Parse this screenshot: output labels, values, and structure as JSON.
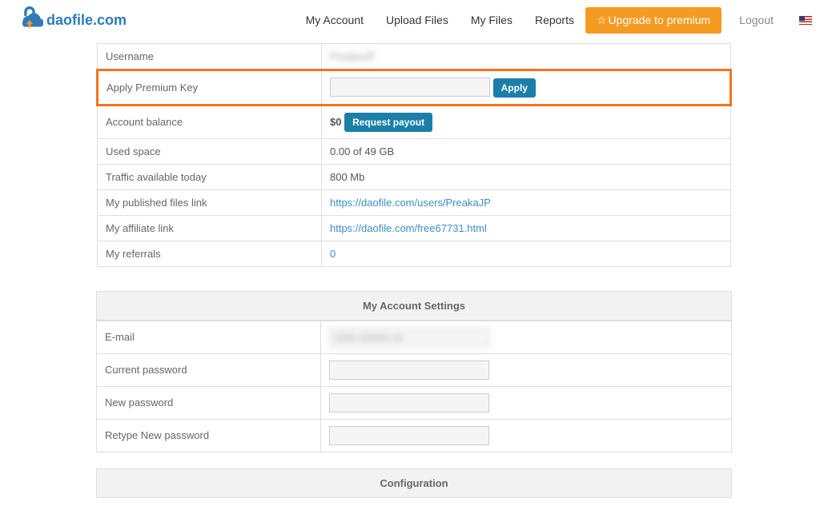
{
  "header": {
    "site_name": "daofile.com",
    "nav": {
      "my_account": "My Account",
      "upload_files": "Upload Files",
      "my_files": "My Files",
      "reports": "Reports",
      "upgrade": "Upgrade to premium",
      "logout": "Logout"
    }
  },
  "account": {
    "username_label": "Username",
    "username_value": "PreakaJP",
    "apply_premium_label": "Apply Premium Key",
    "apply_btn": "Apply",
    "balance_label": "Account balance",
    "balance_value": "$0",
    "request_payout_btn": "Request payout",
    "used_space_label": "Used space",
    "used_space_value": "0.00 of 49 GB",
    "traffic_label": "Traffic available today",
    "traffic_value": "800 Mb",
    "published_label": "My published files link",
    "published_link": "https://daofile.com/users/PreakaJP",
    "affiliate_label": "My affiliate link",
    "affiliate_link": "https://daofile.com/free67731.html",
    "referrals_label": "My referrals",
    "referrals_value": "0"
  },
  "settings": {
    "header": "My Account Settings",
    "email_label": "E-mail",
    "email_value": "xxxx xxxxxx xx",
    "current_pw_label": "Current password",
    "new_pw_label": "New password",
    "retype_pw_label": "Retype New password"
  },
  "config": {
    "header": "Configuration"
  }
}
